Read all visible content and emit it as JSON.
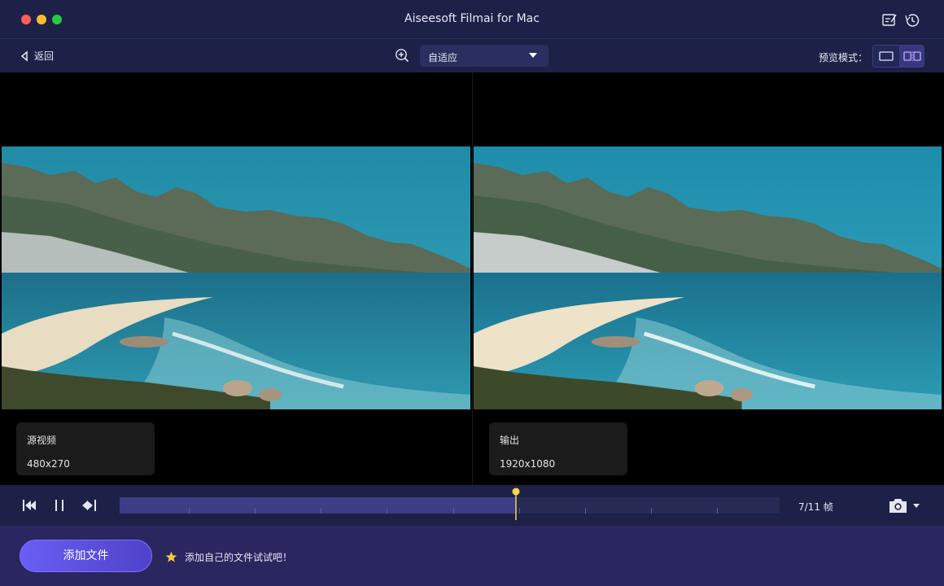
{
  "window": {
    "title": "Aiseesoft Filmai for Mac"
  },
  "toolbar": {
    "back_label": "返回",
    "zoom_value": "自适应",
    "preview_mode_label": "预览模式："
  },
  "panes": {
    "source": {
      "label": "源视频",
      "resolution": "480x270"
    },
    "output": {
      "label": "输出",
      "resolution": "1920x1080"
    }
  },
  "playback": {
    "frame_counter": "7/11 帧",
    "progress_fraction": 0.6,
    "current_frame": 7,
    "total_frames": 11
  },
  "bottom": {
    "add_button_label": "添加文件",
    "tip_text": "添加自己的文件试试吧！"
  },
  "colors": {
    "titlebar_bg": "#1d2148",
    "bottom_bg": "#2a2660",
    "accent": "#6a5df5",
    "playhead": "#f5d54a"
  }
}
